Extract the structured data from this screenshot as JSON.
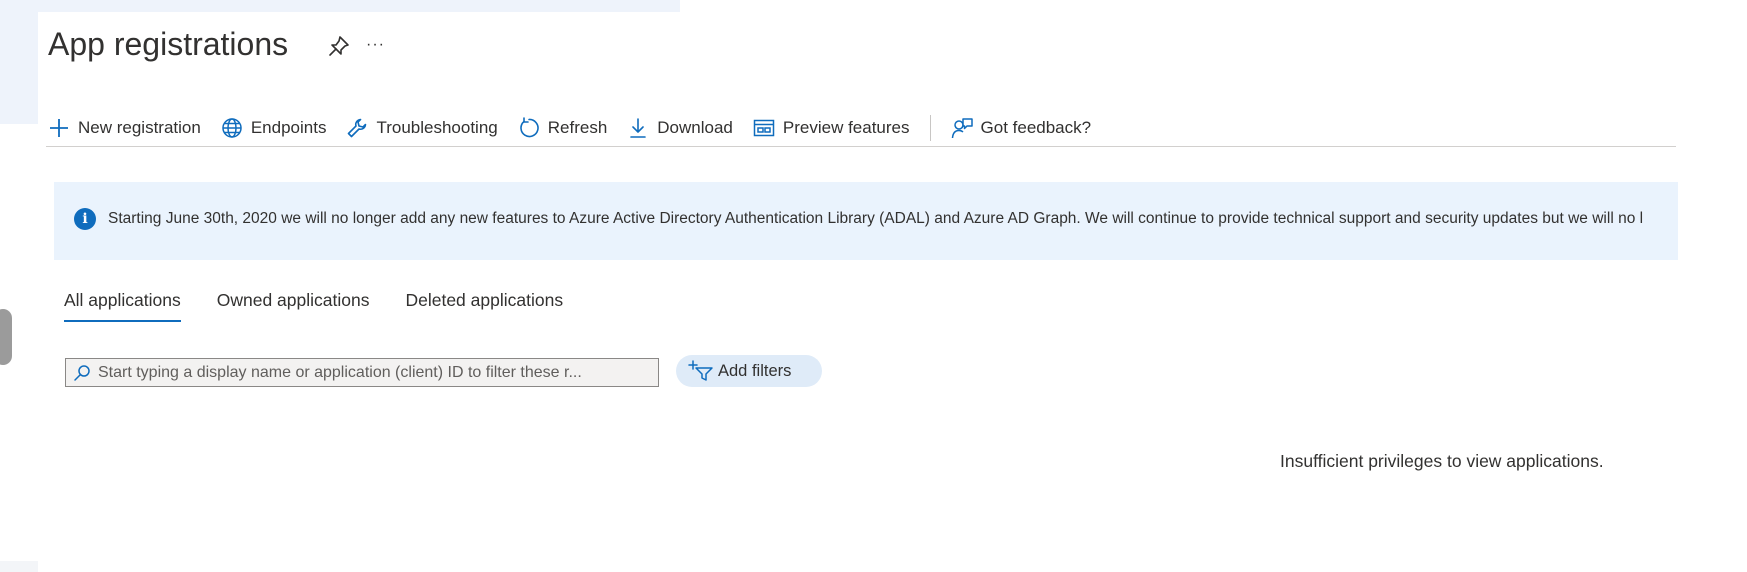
{
  "page": {
    "title": "App registrations",
    "more_label": "···"
  },
  "toolbar": {
    "items": [
      {
        "label": "New registration",
        "icon": "plus-icon"
      },
      {
        "label": "Endpoints",
        "icon": "globe-icon"
      },
      {
        "label": "Troubleshooting",
        "icon": "wrench-icon"
      },
      {
        "label": "Refresh",
        "icon": "refresh-icon"
      },
      {
        "label": "Download",
        "icon": "download-icon"
      },
      {
        "label": "Preview features",
        "icon": "preview-features-icon"
      },
      {
        "label": "Got feedback?",
        "icon": "feedback-icon"
      }
    ]
  },
  "banner": {
    "icon": "info-icon",
    "text": "Starting June 30th, 2020 we will no longer add any new features to Azure Active Directory Authentication Library (ADAL) and Azure AD Graph. We will continue to provide technical support and security updates but we will no l"
  },
  "tabs": [
    {
      "label": "All applications",
      "active": true
    },
    {
      "label": "Owned applications",
      "active": false
    },
    {
      "label": "Deleted applications",
      "active": false
    }
  ],
  "search": {
    "placeholder": "Start typing a display name or application (client) ID to filter these r...",
    "value": ""
  },
  "filters": {
    "add_label": "Add filters"
  },
  "empty_state": {
    "message": "Insufficient privileges to view applications."
  },
  "colors": {
    "accent": "#0f6cbd",
    "banner_bg": "#eaf3fd",
    "filter_bg": "#dfebf8",
    "text": "#323130"
  }
}
